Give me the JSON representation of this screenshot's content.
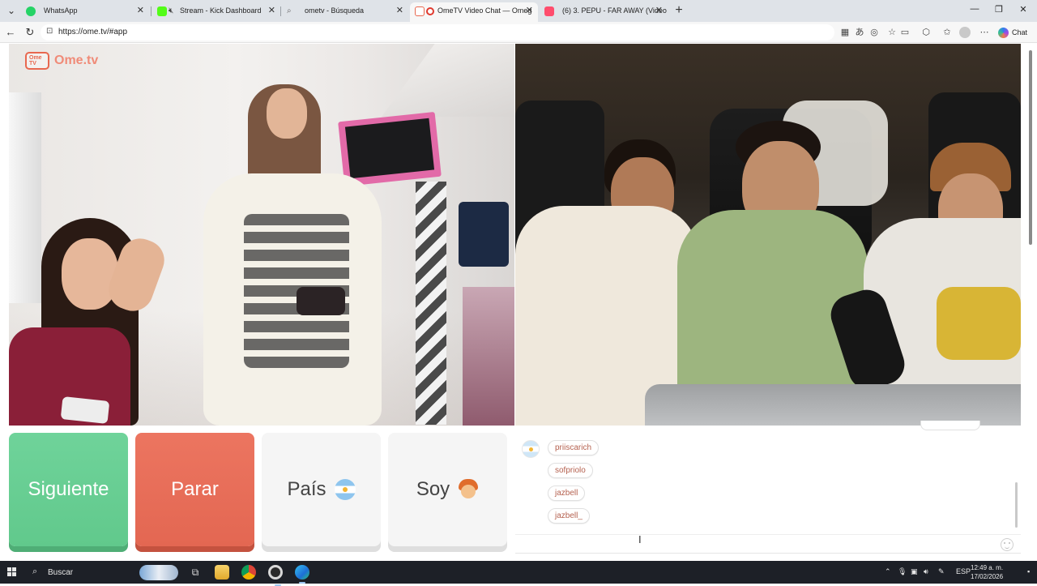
{
  "browser": {
    "tabs": [
      {
        "title": "WhatsApp",
        "icon": "whatsapp-icon",
        "color": "#25d366",
        "active": false
      },
      {
        "title": "Stream - Kick Dashboard",
        "icon": "kick-icon",
        "color": "#53fc18",
        "active": false,
        "muted": true
      },
      {
        "title": "ometv - Búsqueda",
        "icon": "search-icon",
        "color": "#7a7a7a",
        "active": false
      },
      {
        "title": "OmeTV Video Chat — Omeg",
        "icon": "ometv-icon",
        "color": "#e8684f",
        "active": true
      },
      {
        "title": "(6) 3. PEPU - FAR AWAY (Video Ofi",
        "icon": "youtube-icon",
        "color": "#ff0033",
        "active": false
      }
    ],
    "url": "https://ome.tv/#app",
    "copilot_label": "Chat"
  },
  "app": {
    "logo_text": "Ome.tv",
    "logo_badge": "Ome TV",
    "buttons": {
      "next": "Siguiente",
      "stop": "Parar",
      "country": "País",
      "gender": "Soy"
    },
    "chat_messages": [
      "priiscarich",
      "sofpriolo",
      "jazbell",
      "jazbell_"
    ]
  },
  "taskbar": {
    "search_label": "Buscar",
    "language": "ESP",
    "time": "12:49 a. m.",
    "date": "17/02/2026"
  },
  "colors": {
    "next": "#61c98c",
    "stop": "#e36752",
    "accent": "#e8684f",
    "chat_text": "#b5614f"
  }
}
